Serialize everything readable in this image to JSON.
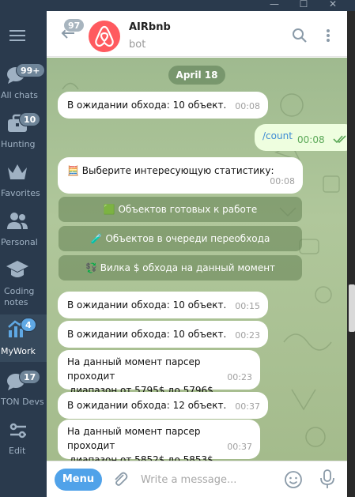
{
  "window": {
    "minimize": "—",
    "maximize": "☐",
    "close": "✕"
  },
  "sidebar": {
    "folders": [
      {
        "label": "All chats",
        "badge": "99+",
        "icon": "chats-icon"
      },
      {
        "label": "Hunting",
        "badge": "10",
        "icon": "briefcase-icon"
      },
      {
        "label": "Favorites",
        "badge": "",
        "icon": "crown-icon"
      },
      {
        "label": "Personal",
        "badge": "",
        "icon": "people-icon"
      },
      {
        "label": "Coding notes",
        "badge": "",
        "icon": "graduation-cap-icon"
      },
      {
        "label": "MyWork",
        "badge": "4",
        "icon": "chart-icon",
        "active": true
      },
      {
        "label": "TON Devs",
        "badge": "17",
        "icon": "chats-icon"
      },
      {
        "label": "Edit",
        "badge": "",
        "icon": "sliders-icon"
      }
    ]
  },
  "header": {
    "unread_count": "97",
    "title": "AIRbnb",
    "subtitle": "bot"
  },
  "chat": {
    "date": "April 18",
    "messages": [
      {
        "text": "В ожидании обхода: 10 объект.",
        "time": "00:08"
      },
      {
        "text": "/count",
        "time": "00:08"
      },
      {
        "text": "🧮 Выберите интересующую статистику:",
        "time": "00:08"
      },
      {
        "text": "В ожидании обхода: 10 объект.",
        "time": "00:15"
      },
      {
        "text": "В ожидании обхода: 10 объект.",
        "time": "00:23"
      },
      {
        "line1": "На данный момент парсер проходит",
        "line2": "диапазон от 5795$ до 5796$",
        "time": "00:23"
      },
      {
        "text": "В ожидании обхода: 12 объект.",
        "time": "00:37"
      },
      {
        "line1": "На данный момент парсер проходит",
        "line2": "диапазон от 5852$ до 5853$",
        "time": "00:37"
      }
    ],
    "keyboard": [
      "🟩 Объектов готовых к работе",
      "🧪 Объектов в очереди переобхода",
      "💱 Вилка $ обхода на данный момент"
    ]
  },
  "composer": {
    "menu_label": "Menu",
    "placeholder": "Write a message..."
  }
}
